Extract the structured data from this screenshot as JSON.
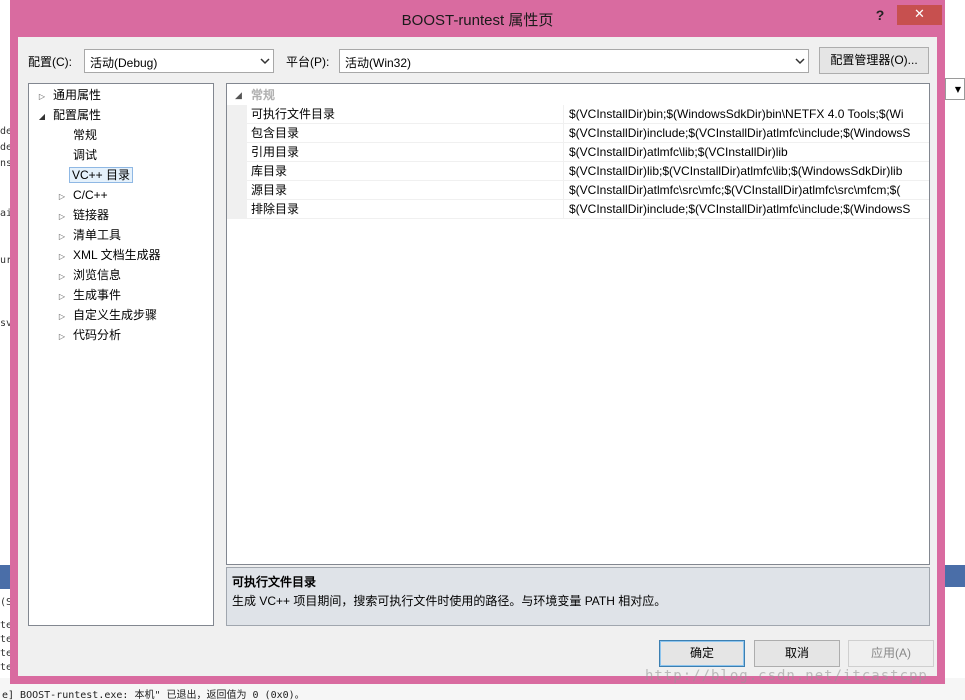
{
  "window": {
    "title": "BOOST-runtest 属性页",
    "help_label": "?",
    "close_label": "✕"
  },
  "config_row": {
    "config_label": "配置(C):",
    "config_value": "活动(Debug)",
    "platform_label": "平台(P):",
    "platform_value": "活动(Win32)",
    "manager_button": "配置管理器(O)..."
  },
  "tree": {
    "items": [
      {
        "label": "通用属性",
        "expander": "collapsed"
      },
      {
        "label": "配置属性",
        "expander": "expanded"
      },
      {
        "label": "常规",
        "expander": "none"
      },
      {
        "label": "调试",
        "expander": "none"
      },
      {
        "label": "VC++ 目录",
        "expander": "none",
        "selected": true
      },
      {
        "label": "C/C++",
        "expander": "collapsed"
      },
      {
        "label": "链接器",
        "expander": "collapsed"
      },
      {
        "label": "清单工具",
        "expander": "collapsed"
      },
      {
        "label": "XML 文档生成器",
        "expander": "collapsed"
      },
      {
        "label": "浏览信息",
        "expander": "collapsed"
      },
      {
        "label": "生成事件",
        "expander": "collapsed"
      },
      {
        "label": "自定义生成步骤",
        "expander": "collapsed"
      },
      {
        "label": "代码分析",
        "expander": "collapsed"
      }
    ]
  },
  "grid": {
    "category": "常规",
    "rows": [
      {
        "name": "可执行文件目录",
        "value": "$(VCInstallDir)bin;$(WindowsSdkDir)bin\\NETFX 4.0 Tools;$(Wi"
      },
      {
        "name": "包含目录",
        "value": "$(VCInstallDir)include;$(VCInstallDir)atlmfc\\include;$(WindowsS"
      },
      {
        "name": "引用目录",
        "value": "$(VCInstallDir)atlmfc\\lib;$(VCInstallDir)lib"
      },
      {
        "name": "库目录",
        "value": "$(VCInstallDir)lib;$(VCInstallDir)atlmfc\\lib;$(WindowsSdkDir)lib"
      },
      {
        "name": "源目录",
        "value": "$(VCInstallDir)atlmfc\\src\\mfc;$(VCInstallDir)atlmfc\\src\\mfcm;$("
      },
      {
        "name": "排除目录",
        "value": "$(VCInstallDir)include;$(VCInstallDir)atlmfc\\include;$(WindowsS"
      }
    ]
  },
  "description": {
    "title": "可执行文件目录",
    "text": "生成 VC++ 项目期间，搜索可执行文件时使用的路径。与环境变量 PATH 相对应。"
  },
  "buttons": {
    "ok": "确定",
    "cancel": "取消",
    "apply": "应用(A)"
  },
  "background": {
    "left_fragments": [
      "de",
      "de",
      "ns",
      "ai",
      "ur",
      "sv",
      "(S",
      "te",
      "te",
      "te",
      "te"
    ],
    "bottom_line": "e] BOOST-runtest.exe: 本机\" 已退出，返回值为 0 (0x0)。",
    "watermark": "http://blog.csdn.net/itcastcpp"
  },
  "colors": {
    "frame": "#d96ba0",
    "close": "#c7504f",
    "client": "#f0f0f0",
    "description_bg": "#dfe3e8"
  }
}
